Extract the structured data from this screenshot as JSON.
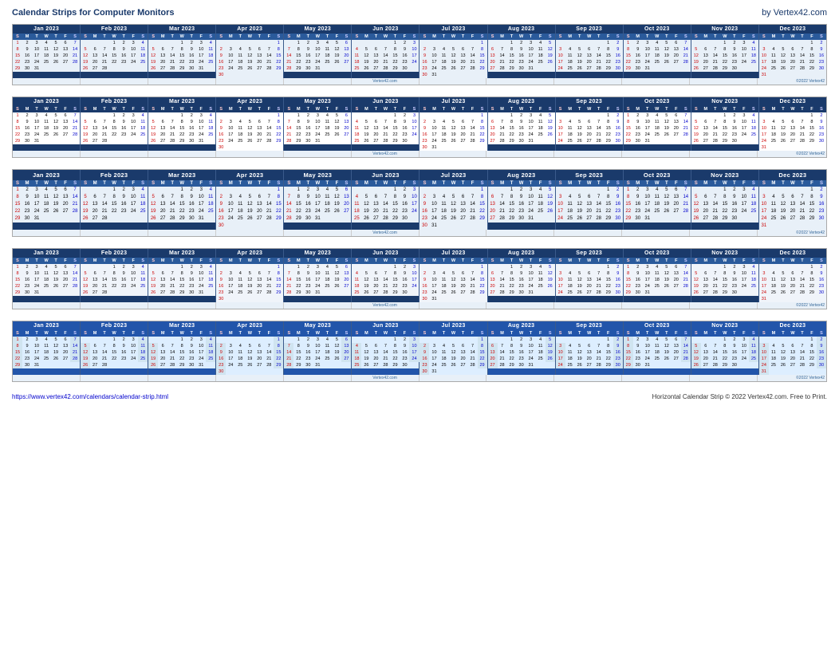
{
  "header": {
    "title": "Calendar Strips for Computer Monitors",
    "brand": "by Vertex42.com"
  },
  "footer": {
    "url": "https://www.vertex42.com/calendars/calendar-strip.html",
    "copyright": "Horizontal Calendar Strip © 2022 Vertex42.com. Free to Print."
  },
  "watermark": "Vertex42.com",
  "copyright_short": "©2022 Vertex42",
  "months": [
    {
      "name": "Jan 2023",
      "startDay": 0,
      "days": 31
    },
    {
      "name": "Feb 2023",
      "startDay": 3,
      "days": 28
    },
    {
      "name": "Mar 2023",
      "startDay": 3,
      "days": 31
    },
    {
      "name": "Apr 2023",
      "startDay": 6,
      "days": 30
    },
    {
      "name": "May 2023",
      "startDay": 1,
      "days": 31
    },
    {
      "name": "Jun 2023",
      "startDay": 4,
      "days": 30
    },
    {
      "name": "Jul 2023",
      "startDay": 6,
      "days": 31
    },
    {
      "name": "Aug 2023",
      "startDay": 2,
      "days": 31
    },
    {
      "name": "Sep 2023",
      "startDay": 5,
      "days": 30
    },
    {
      "name": "Oct 2023",
      "startDay": 0,
      "days": 31
    },
    {
      "name": "Nov 2023",
      "startDay": 3,
      "days": 30
    },
    {
      "name": "Dec 2023",
      "startDay": 5,
      "days": 31
    }
  ]
}
